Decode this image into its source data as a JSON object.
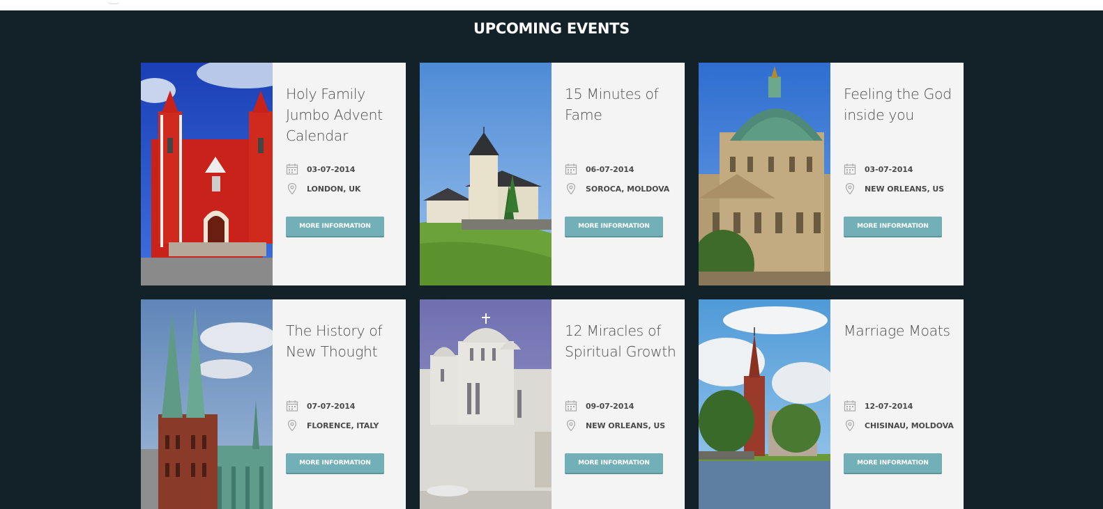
{
  "section": {
    "title": "UPCOMING EVENTS"
  },
  "events": [
    {
      "title": "Holy Family Jumbo Advent Calendar",
      "date": "03-07-2014",
      "location": "LONDON, UK",
      "button": "MORE INFORMATION",
      "image": "red-church-photo"
    },
    {
      "title": "15 Minutes of Fame",
      "date": "06-07-2014",
      "location": "SOROCA, MOLDOVA",
      "button": "MORE INFORMATION",
      "image": "hill-chapel-photo"
    },
    {
      "title": "Feeling the God inside you",
      "date": "03-07-2014",
      "location": "NEW ORLEANS, US",
      "button": "MORE INFORMATION",
      "image": "domed-cathedral-photo"
    },
    {
      "title": "The History of New Thought",
      "date": "07-07-2014",
      "location": "FLORENCE, ITALY",
      "button": "MORE INFORMATION",
      "image": "twin-spire-church-photo"
    },
    {
      "title": "12 Miracles of Spiritual Growth",
      "date": "09-07-2014",
      "location": "NEW ORLEANS, US",
      "button": "MORE INFORMATION",
      "image": "orthodox-church-photo"
    },
    {
      "title": "Marriage Moats",
      "date": "12-07-2014",
      "location": "CHISINAU, MOLDOVA",
      "button": "MORE INFORMATION",
      "image": "lakeside-church-photo"
    }
  ],
  "colors": {
    "background": "#132229",
    "card": "#f4f4f4",
    "button": "#72afb6",
    "title_text": "#4d4d4d",
    "meta_text": "#4a4a4a"
  }
}
